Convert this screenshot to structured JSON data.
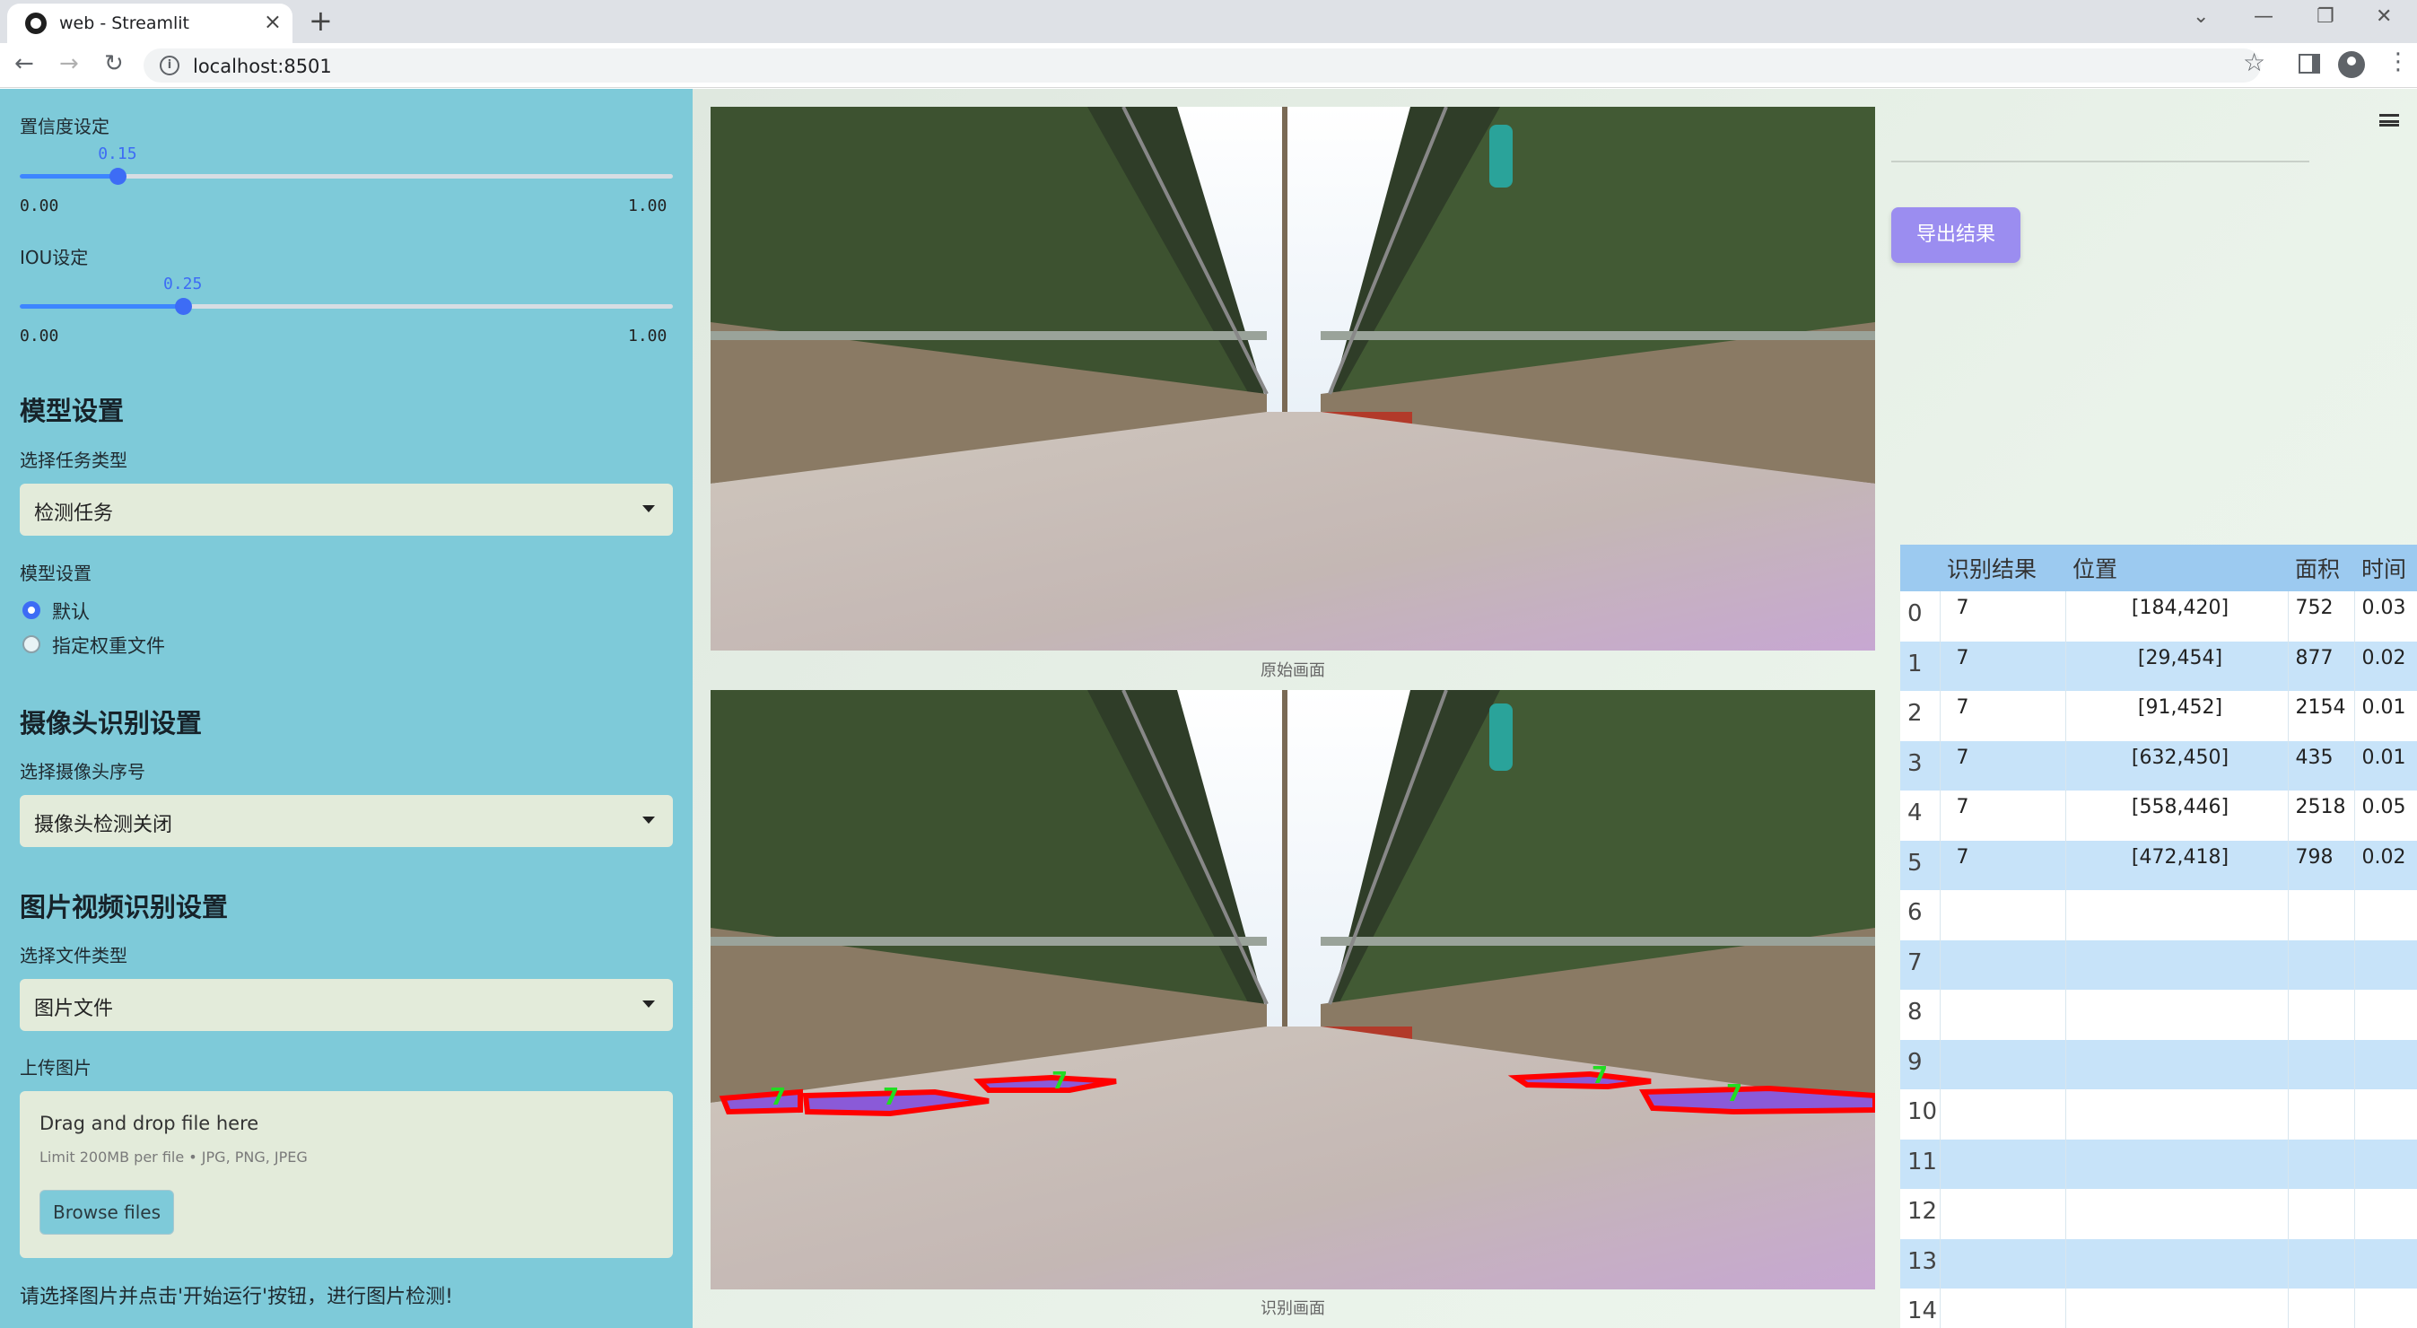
{
  "browser": {
    "tab_title": "web - Streamlit",
    "url": "localhost:8501"
  },
  "sidebar": {
    "confidence": {
      "label": "置信度设定",
      "value": "0.15",
      "fraction": 0.15,
      "min": "0.00",
      "max": "1.00"
    },
    "iou": {
      "label": "IOU设定",
      "value": "0.25",
      "fraction": 0.25,
      "min": "0.00",
      "max": "1.00"
    },
    "model_section": {
      "heading": "模型设置",
      "task_label": "选择任务类型",
      "task_value": "检测任务",
      "model_label": "模型设置",
      "radio_default": "默认",
      "radio_custom": "指定权重文件"
    },
    "camera_section": {
      "heading": "摄像头识别设置",
      "camera_label": "选择摄像头序号",
      "camera_value": "摄像头检测关闭"
    },
    "media_section": {
      "heading": "图片视频识别设置",
      "file_type_label": "选择文件类型",
      "file_type_value": "图片文件",
      "upload_label": "上传图片",
      "drag_text": "Drag and drop file here",
      "limit_text": "Limit 200MB per file • JPG, PNG, JPEG",
      "browse_label": "Browse files"
    },
    "hint": "请选择图片并点击'开始运行'按钮，进行图片检测!"
  },
  "main": {
    "original_caption": "原始画面",
    "result_caption": "识别画面",
    "export_label": "导出结果",
    "detections": [
      {
        "label": "7"
      },
      {
        "label": "7"
      },
      {
        "label": "7"
      },
      {
        "label": "7"
      },
      {
        "label": "7"
      }
    ],
    "table": {
      "headers": [
        "",
        "识别结果",
        "位置",
        "面积",
        "时间"
      ],
      "rows": [
        {
          "idx": "0",
          "label": "7",
          "pos": "[184,420]",
          "area": "752",
          "time": "0.03"
        },
        {
          "idx": "1",
          "label": "7",
          "pos": "[29,454]",
          "area": "877",
          "time": "0.02"
        },
        {
          "idx": "2",
          "label": "7",
          "pos": "[91,452]",
          "area": "2154",
          "time": "0.01"
        },
        {
          "idx": "3",
          "label": "7",
          "pos": "[632,450]",
          "area": "435",
          "time": "0.01"
        },
        {
          "idx": "4",
          "label": "7",
          "pos": "[558,446]",
          "area": "2518",
          "time": "0.05"
        },
        {
          "idx": "5",
          "label": "7",
          "pos": "[472,418]",
          "area": "798",
          "time": "0.02"
        },
        {
          "idx": "6",
          "label": "",
          "pos": "",
          "area": "",
          "time": ""
        },
        {
          "idx": "7",
          "label": "",
          "pos": "",
          "area": "",
          "time": ""
        },
        {
          "idx": "8",
          "label": "",
          "pos": "",
          "area": "",
          "time": ""
        },
        {
          "idx": "9",
          "label": "",
          "pos": "",
          "area": "",
          "time": ""
        },
        {
          "idx": "10",
          "label": "",
          "pos": "",
          "area": "",
          "time": ""
        },
        {
          "idx": "11",
          "label": "",
          "pos": "",
          "area": "",
          "time": ""
        },
        {
          "idx": "12",
          "label": "",
          "pos": "",
          "area": "",
          "time": ""
        },
        {
          "idx": "13",
          "label": "",
          "pos": "",
          "area": "",
          "time": ""
        },
        {
          "idx": "14",
          "label": "",
          "pos": "",
          "area": "",
          "time": ""
        }
      ]
    }
  },
  "colors": {
    "sidebar_bg": "#7ecad9",
    "slider_accent": "#3d6cf5",
    "export_button": "#9b8df0",
    "table_header": "#9ccaf0",
    "table_stripe": "#c7e3f9",
    "detection_outline": "#ff0000",
    "detection_label": "#22dd22"
  },
  "icons": {
    "favicon": "streamlit-logo-icon",
    "tab_close": "close-icon",
    "new_tab": "plus-icon",
    "back": "arrow-left-icon",
    "forward": "arrow-right-icon",
    "reload": "reload-icon",
    "site_info": "info-icon",
    "bookmark": "star-icon",
    "side_panel": "side-panel-icon",
    "profile": "profile-icon",
    "browser_menu": "kebab-menu-icon",
    "app_menu": "hamburger-menu-icon",
    "dropdown": "chevron-down-icon"
  }
}
